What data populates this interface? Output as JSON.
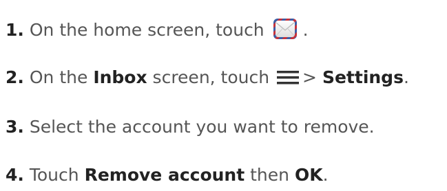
{
  "steps": [
    {
      "number": "1.",
      "text_before": "On the home screen, touch",
      "icon": "mail-icon",
      "text_after": "."
    },
    {
      "number": "2.",
      "text_1": "On the ",
      "bold_1": "Inbox",
      "text_2": " screen, touch",
      "icon": "menu-icon",
      "text_3": "> ",
      "bold_2": "Settings",
      "text_4": "."
    },
    {
      "number": "3.",
      "text": "Select the account you want to remove."
    },
    {
      "number": "4.",
      "text_1": "Touch ",
      "bold_1": "Remove account",
      "text_2": " then ",
      "bold_2": "OK",
      "text_3": "."
    }
  ],
  "colors": {
    "text": "#555555",
    "number": "#222222",
    "icon_envelope_border_red": "#c8323a",
    "icon_envelope_border_blue": "#3a5fa8"
  }
}
